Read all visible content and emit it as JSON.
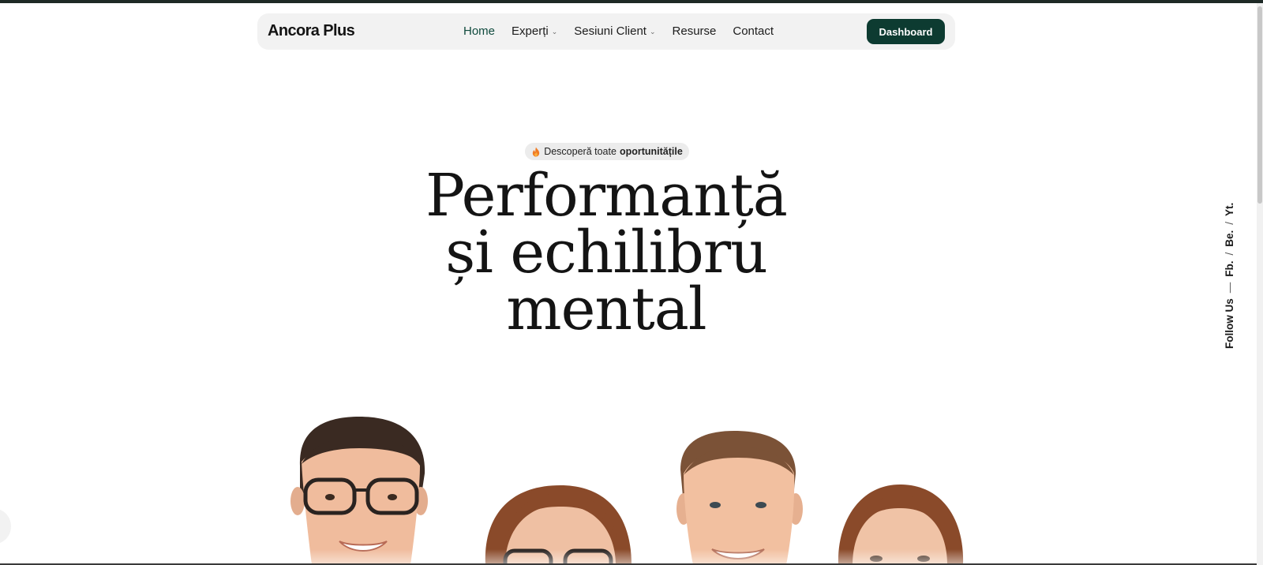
{
  "brand": {
    "name": "Ancora Plus",
    "accent": "#0d3b31",
    "active_link_color": "#0f4a3d"
  },
  "nav": {
    "links": [
      {
        "label": "Home",
        "active": true,
        "dropdown": false
      },
      {
        "label": "Experți",
        "active": false,
        "dropdown": true
      },
      {
        "label": "Sesiuni Client",
        "active": false,
        "dropdown": true
      },
      {
        "label": "Resurse",
        "active": false,
        "dropdown": false
      },
      {
        "label": "Contact",
        "active": false,
        "dropdown": false
      }
    ],
    "cta_label": "Dashboard"
  },
  "hero": {
    "badge_icon": "fire-icon",
    "badge_text": "Descoperă toate ",
    "badge_strong": "oportunitățile",
    "title_lines": [
      "Performanță",
      "și echilibru",
      "mental"
    ]
  },
  "social": {
    "label": "Follow Us",
    "dash": "—",
    "separator": "/",
    "links": [
      "Fb.",
      "Be.",
      "Yt."
    ]
  },
  "team": {
    "people": [
      {
        "name": "man-with-glasses-photo"
      },
      {
        "name": "woman-with-glasses-photo"
      },
      {
        "name": "smiling-man-photo"
      },
      {
        "name": "woman-photo"
      }
    ]
  }
}
